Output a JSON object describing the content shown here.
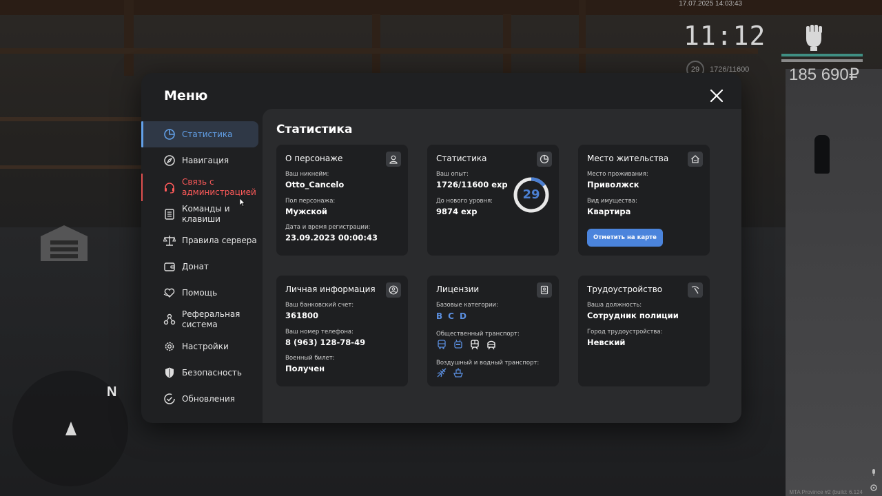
{
  "hud": {
    "date": "17.07.2025 14:03:43",
    "time": "11:12",
    "level": "29",
    "exp": "1726/11600",
    "money": "185 690₽",
    "footer": "MTA Province #2 (build: 6.124"
  },
  "minimap": {
    "north": "N"
  },
  "menu": {
    "title": "Меню",
    "close_icon": "close-icon",
    "nav": [
      {
        "label": "Статистика",
        "icon": "stats-pie-icon"
      },
      {
        "label": "Навигация",
        "icon": "compass-icon"
      },
      {
        "label": "Связь с администрацией",
        "icon": "headset-icon"
      },
      {
        "label": "Команды и клавиши",
        "icon": "keyboard-list-icon"
      },
      {
        "label": "Правила сервера",
        "icon": "scales-icon"
      },
      {
        "label": "Донат",
        "icon": "wallet-icon"
      },
      {
        "label": "Помощь",
        "icon": "heart-hand-icon"
      },
      {
        "label": "Реферальная система",
        "icon": "referral-icon"
      },
      {
        "label": "Настройки",
        "icon": "gear-icon"
      },
      {
        "label": "Безопасность",
        "icon": "shield-icon"
      },
      {
        "label": "Обновления",
        "icon": "check-circle-icon"
      }
    ],
    "active_index": 0,
    "accent": "#62a0e8",
    "alert_color": "#ff5a5a"
  },
  "content": {
    "title": "Статистика",
    "character": {
      "title": "О персонаже",
      "nick_label": "Ваш никнейм:",
      "nick": "Otto_Cancelo",
      "gender_label": "Пол персонажа:",
      "gender": "Мужской",
      "reg_label": "Дата и время регистрации:",
      "reg": "23.09.2023 00:00:43"
    },
    "stats": {
      "title": "Статистика",
      "exp_label": "Ваш опыт:",
      "exp": "1726/11600 exp",
      "next_label": "До нового уровня:",
      "next": "9874 exp",
      "level": "29",
      "progress": 0.1488
    },
    "residence": {
      "title": "Место жительства",
      "place_label": "Место проживания:",
      "place": "Приволжск",
      "type_label": "Вид имущества:",
      "type": "Квартира",
      "button": "Отметить на карте"
    },
    "personal": {
      "title": "Личная информация",
      "bank_label": "Ваш банковский счет:",
      "bank": "361800",
      "phone_label": "Ваш номер телефона:",
      "phone": "8 (963) 128-78-49",
      "military_label": "Военный билет:",
      "military": "Получен"
    },
    "licenses": {
      "title": "Лицензии",
      "base_label": "Базовые категории:",
      "categories": [
        "B",
        "C",
        "D"
      ],
      "public_label": "Общественный транспорт:",
      "air_label": "Воздушный и водный транспорт:",
      "accent": "#5b8fe0"
    },
    "employment": {
      "title": "Трудоустройство",
      "position_label": "Ваша должность:",
      "position": "Сотрудник полиции",
      "city_label": "Город трудоустройства:",
      "city": "Невский"
    }
  }
}
